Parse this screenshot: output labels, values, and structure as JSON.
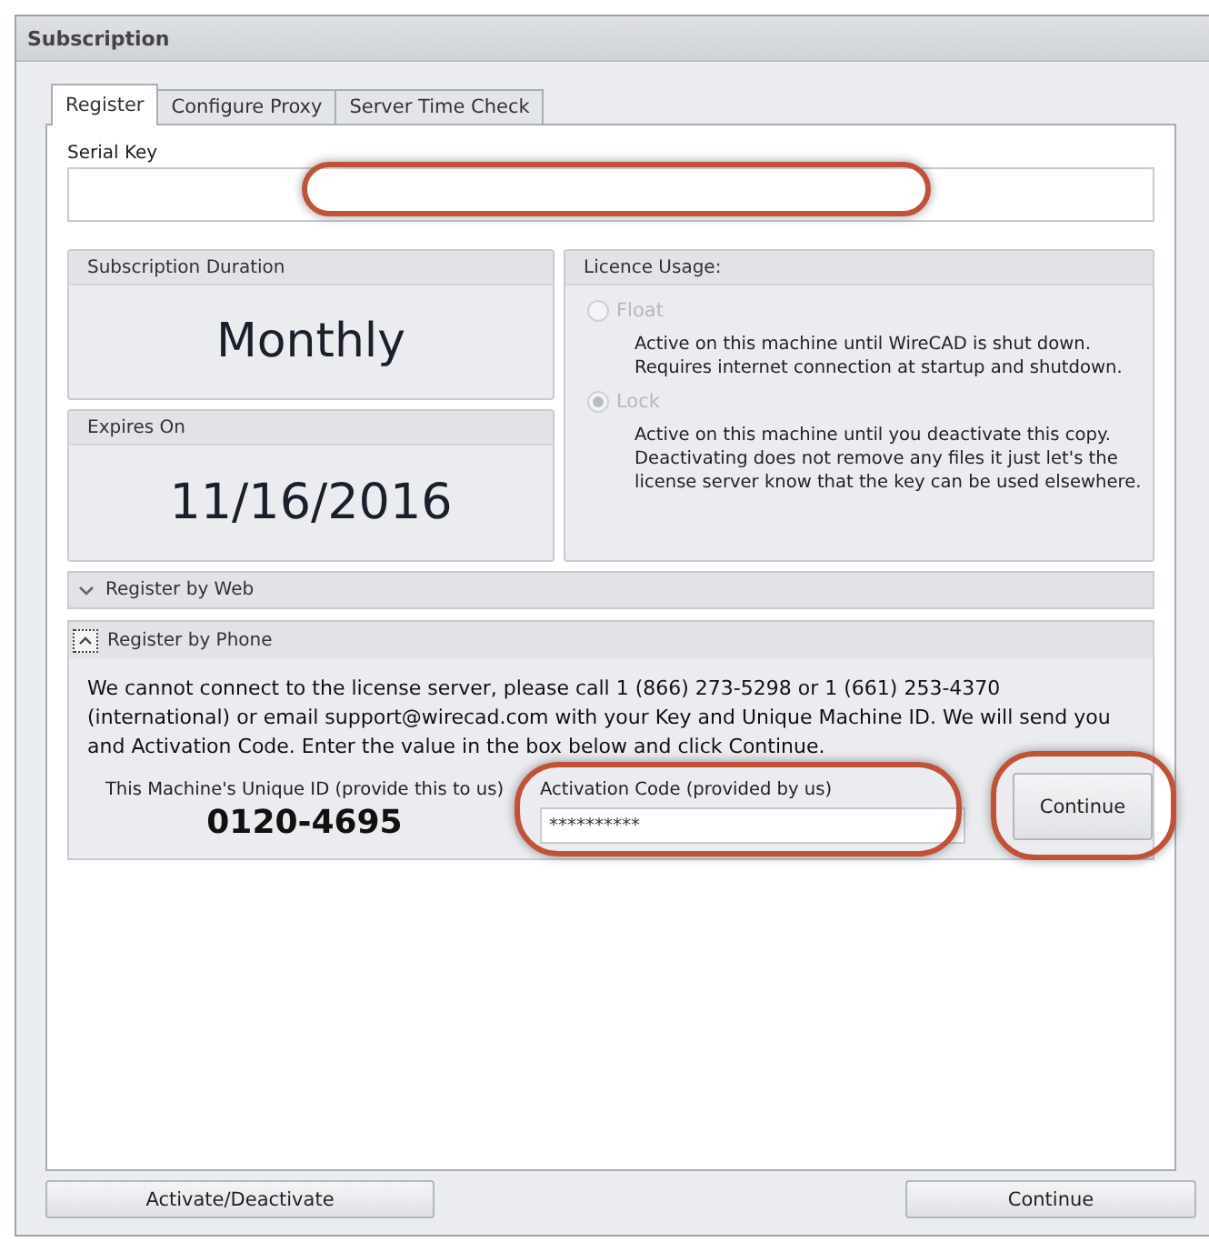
{
  "window": {
    "title": "Subscription"
  },
  "tabs": [
    {
      "label": "Register",
      "selected": true
    },
    {
      "label": "Configure Proxy",
      "selected": false
    },
    {
      "label": "Server Time Check",
      "selected": false
    }
  ],
  "serial_key": {
    "label": "Serial Key"
  },
  "subscription_duration": {
    "label": "Subscription Duration",
    "value": "Monthly"
  },
  "expires_on": {
    "label": "Expires On",
    "value": "11/16/2016"
  },
  "licence_usage": {
    "title": "Licence Usage:",
    "options": [
      {
        "label": "Float",
        "description": "Active on this machine until WireCAD is shut down.\nRequires internet connection at startup and shutdown.",
        "selected": false,
        "disabled": true
      },
      {
        "label": "Lock",
        "description": "Active on this machine until you deactivate this copy.\nDeactivating does not remove any files it just let's the\nlicense server know that the key can be used elsewhere.",
        "selected": true,
        "disabled": true
      }
    ]
  },
  "register_by_web": {
    "title": "Register by Web",
    "expanded": false
  },
  "register_by_phone": {
    "title": "Register by Phone",
    "expanded": true,
    "message": "We cannot connect to the license server, please call 1 (866) 273-5298 or 1 (661) 253-4370 (international) or email support@wirecad.com with your Key and Unique Machine ID. We will send you and Activation Code. Enter the value in the box below and click Continue.",
    "machine_id_label": "This Machine's Unique ID (provide this to us)",
    "machine_id": "0120-4695",
    "activation_label": "Activation Code (provided by us)",
    "activation_value": "**********",
    "button": "Continue"
  },
  "footer_buttons": [
    "Activate/Deactivate",
    "Continue"
  ]
}
